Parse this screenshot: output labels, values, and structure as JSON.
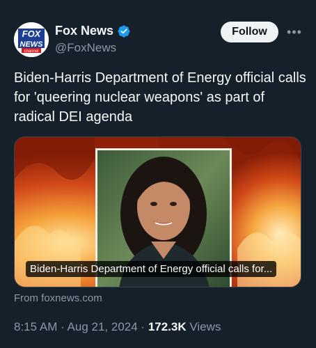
{
  "account": {
    "name": "Fox News",
    "handle": "@FoxNews",
    "logo_lines": [
      "FOX",
      "NEWS",
      "channel"
    ],
    "verified_icon": "verified-badge-icon",
    "verified_color": "#1d9bf0"
  },
  "actions": {
    "follow_label": "Follow",
    "more_label": "•••"
  },
  "tweet": {
    "text": "Biden-Harris Department of Energy official calls for 'queering nuclear weapons' as part of radical DEI agenda"
  },
  "card": {
    "caption": "Biden-Harris Department of Energy official calls for...",
    "source": "From foxnews.com"
  },
  "meta": {
    "time": "8:15 AM",
    "separator": " · ",
    "date": "Aug 21, 2024",
    "views_count": "172.3K",
    "views_label": "Views"
  },
  "colors": {
    "background": "#15202b",
    "text_primary": "#f7f9f9",
    "text_secondary": "#8b98a5",
    "follow_bg": "#eff3f4"
  }
}
